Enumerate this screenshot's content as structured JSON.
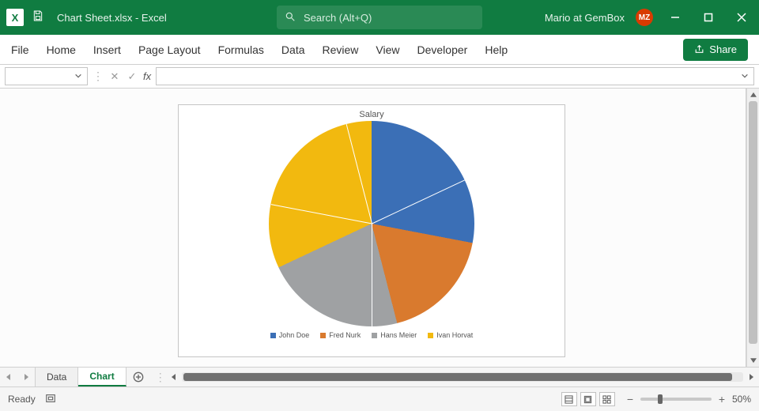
{
  "titlebar": {
    "filename": "Chart Sheet.xlsx",
    "app_suffix": "  -  Excel",
    "search_placeholder": "Search (Alt+Q)",
    "user_label": "Mario at GemBox",
    "user_initials": "MZ"
  },
  "ribbon": {
    "tabs": [
      "File",
      "Home",
      "Insert",
      "Page Layout",
      "Formulas",
      "Data",
      "Review",
      "View",
      "Developer",
      "Help"
    ],
    "share_label": "Share"
  },
  "formula_bar": {
    "namebox_value": "",
    "fx_label": "fx",
    "formula_value": ""
  },
  "sheets": {
    "tabs": [
      {
        "label": "Data",
        "active": false
      },
      {
        "label": "Chart",
        "active": true
      }
    ]
  },
  "statusbar": {
    "ready": "Ready",
    "zoom_text": "50%"
  },
  "chart_data": {
    "type": "pie",
    "title": "Salary",
    "series_name": "Salary",
    "categories": [
      "John Doe",
      "Fred Nurk",
      "Hans Meier",
      "Ivan Horvat"
    ],
    "values": [
      28,
      18,
      22,
      32
    ],
    "colors": [
      "#3b6fb6",
      "#d97a2e",
      "#9fa1a3",
      "#f2b90f"
    ],
    "legend_position": "bottom"
  }
}
